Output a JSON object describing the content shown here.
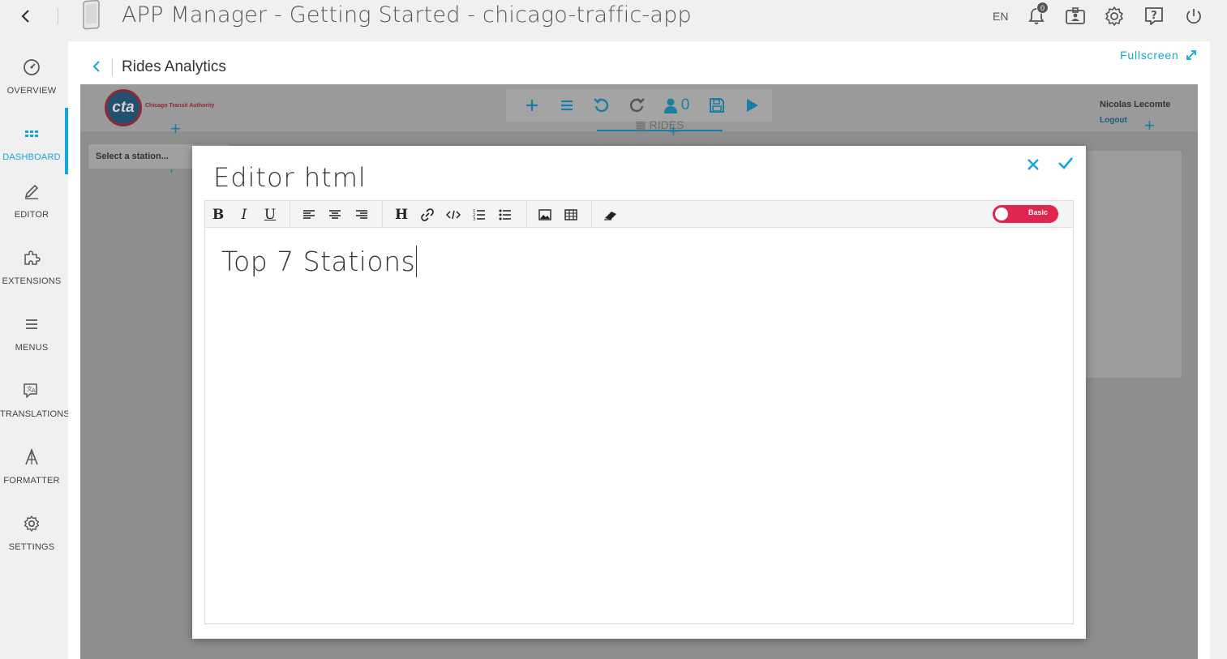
{
  "app": {
    "title": "APP Manager - Getting Started - chicago-traffic-app",
    "language": "EN",
    "notification_count": "0"
  },
  "sidebar": {
    "items": [
      {
        "label": "OVERVIEW",
        "icon": "speedometer-icon"
      },
      {
        "label": "DASHBOARD",
        "icon": "dashboard-grid-icon",
        "active": true
      },
      {
        "label": "EDITOR",
        "icon": "pencil-icon"
      },
      {
        "label": "EXTENSIONS",
        "icon": "puzzle-icon"
      },
      {
        "label": "MENUS",
        "icon": "menu-lines-icon"
      },
      {
        "label": "TRANSLATIONS",
        "icon": "translate-icon"
      },
      {
        "label": "FORMATTER",
        "icon": "formatter-icon"
      },
      {
        "label": "SETTINGS",
        "icon": "gear-icon"
      }
    ]
  },
  "page": {
    "title": "Rides Analytics",
    "fullscreen_label": "Fullscreen"
  },
  "dashboard": {
    "logo_text": "cta",
    "logo_caption": "Chicago Transit Authority",
    "tab_label": "RIDES",
    "user_count": "0",
    "user_name": "Nicolas Lecomte",
    "logout_label": "Logout",
    "station_select_placeholder": "Select a station..."
  },
  "modal": {
    "title": "Editor html",
    "toolbar": {
      "bold": "B",
      "italic": "I",
      "underline": "U",
      "heading": "H",
      "mode_toggle_label": "Basic"
    },
    "content": "Top 7 Stations"
  },
  "colors": {
    "accent": "#17a5d6",
    "toggle": "#e0254f",
    "overlay": "#8e8e8e"
  }
}
